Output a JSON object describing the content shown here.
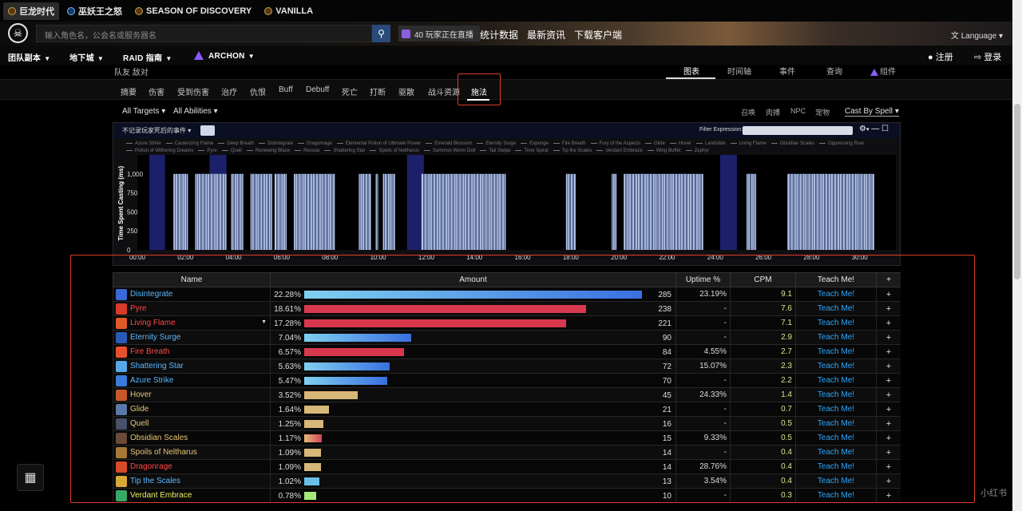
{
  "game_tabs": [
    "巨龙时代",
    "巫妖王之怒",
    "SEASON OF DISCOVERY",
    "VANILLA"
  ],
  "header": {
    "search_placeholder": "输入角色名，公会名或服务器名",
    "live_text": "40 玩家正在直播",
    "links": [
      "统计数据",
      "最新资讯",
      "下载客户端"
    ],
    "language": "Language"
  },
  "nav": {
    "items": [
      "团队副本",
      "地下城",
      "RAID 指南",
      "ARCHON"
    ],
    "register": "注册",
    "login": "登录"
  },
  "report": {
    "ally_enemy": "队友 敌对",
    "view_tabs": [
      "图表",
      "时间轴",
      "事件",
      "查询",
      "组件"
    ],
    "categories": [
      "摘要",
      "伤害",
      "受到伤害",
      "治疗",
      "仇恨",
      "Buff",
      "Debuff",
      "死亡",
      "打断",
      "驱散",
      "战斗资源",
      "施法"
    ],
    "targets": "All Targets",
    "abilities": "All Abilities",
    "right_filters": [
      "召唤",
      "肉搏",
      "NPC",
      "宠物"
    ],
    "cast_by": "Cast By Spell"
  },
  "chart_panel": {
    "event_dropdown": "不记录玩家死后的事件",
    "filter_label": "Filter Expression:"
  },
  "chart_data": {
    "type": "bar",
    "ylabel": "Time Spent Casting (ms)",
    "ylim": [
      0,
      1250
    ],
    "yticks": [
      "0",
      "250",
      "500",
      "750",
      "1,000"
    ],
    "xlim": [
      0,
      31.5
    ],
    "xticks": [
      "00:00",
      "02:00",
      "04:00",
      "06:00",
      "08:00",
      "10:00",
      "12:00",
      "14:00",
      "16:00",
      "18:00",
      "20:00",
      "22:00",
      "24:00",
      "26:00",
      "28:00",
      "30:00"
    ],
    "bar_value": 1000,
    "cast_windows": [
      {
        "start": 1.5,
        "end": 2.1
      },
      {
        "start": 2.4,
        "end": 3.7
      },
      {
        "start": 3.9,
        "end": 4.4
      },
      {
        "start": 4.7,
        "end": 5.6
      },
      {
        "start": 5.7,
        "end": 6.2
      },
      {
        "start": 6.5,
        "end": 8.2
      },
      {
        "start": 9.2,
        "end": 9.7
      },
      {
        "start": 9.9,
        "end": 10.0
      },
      {
        "start": 10.2,
        "end": 10.7
      },
      {
        "start": 11.8,
        "end": 15.3
      },
      {
        "start": 17.8,
        "end": 18.2
      },
      {
        "start": 19.7,
        "end": 19.9
      },
      {
        "start": 20.2,
        "end": 23.5
      },
      {
        "start": 25.3,
        "end": 25.7
      },
      {
        "start": 27.0,
        "end": 30.6
      }
    ],
    "boss_phases": [
      {
        "start": 0.5,
        "end": 1.15
      },
      {
        "start": 3.0,
        "end": 3.7
      },
      {
        "start": 11.2,
        "end": 11.9
      },
      {
        "start": 24.2,
        "end": 24.9
      }
    ],
    "legend": [
      "Azure Strike",
      "Cauterizing Flame",
      "Deep Breath",
      "Disintegrate",
      "Dragonrage",
      "Elemental Potion of Ultimate Power",
      "Emerald Blossom",
      "Eternity Surge",
      "Expunge",
      "Fire Breath",
      "Fury of the Aspects",
      "Glide",
      "Hover",
      "Landslide",
      "Living Flame",
      "Obsidian Scales",
      "Oppressing Roar",
      "Potion of Withering Dreams",
      "Pyre",
      "Quell",
      "Renewing Blaze",
      "Rescue",
      "Shattering Star",
      "Spoils of Neltharus",
      "Summon Worm Doll",
      "Tail Swipe",
      "Time Spiral",
      "Tip the Scales",
      "Verdant Embrace",
      "Wing Buffet",
      "Zephyr"
    ]
  },
  "table": {
    "headers": [
      "Name",
      "Amount",
      "Uptime %",
      "CPM",
      "Teach Me!",
      "+"
    ],
    "rows": [
      {
        "name": "Disintegrate",
        "pct": "22.28%",
        "value": 22.28,
        "casts": "285",
        "uptime": "23.19%",
        "cpm": "9.1",
        "teach": "Teach Me!",
        "name_color": "#5ab8ff",
        "bar_color": "linear-gradient(90deg,#7fd0f0,#3a70e0)",
        "icon_color": "#3a6ad8",
        "has_dropdown": false
      },
      {
        "name": "Pyre",
        "pct": "18.61%",
        "value": 18.61,
        "casts": "238",
        "uptime": "-",
        "cpm": "7.6",
        "teach": "Teach Me!",
        "name_color": "#ff4848",
        "bar_color": "#d8384e",
        "icon_color": "#d83a2a",
        "has_dropdown": false
      },
      {
        "name": "Living Flame",
        "pct": "17.28%",
        "value": 17.28,
        "casts": "221",
        "uptime": "-",
        "cpm": "7.1",
        "teach": "Teach Me!",
        "name_color": "#ff4848",
        "bar_color": "#d8384e",
        "icon_color": "#e05a28",
        "has_dropdown": true
      },
      {
        "name": "Eternity Surge",
        "pct": "7.04%",
        "value": 7.04,
        "casts": "90",
        "uptime": "-",
        "cpm": "2.9",
        "teach": "Teach Me!",
        "name_color": "#5ab8ff",
        "bar_color": "linear-gradient(90deg,#7fd0f0,#3a70e0)",
        "icon_color": "#2a5ab8",
        "has_dropdown": false
      },
      {
        "name": "Fire Breath",
        "pct": "6.57%",
        "value": 6.57,
        "casts": "84",
        "uptime": "4.55%",
        "cpm": "2.7",
        "teach": "Teach Me!",
        "name_color": "#ff4848",
        "bar_color": "#d8384e",
        "icon_color": "#e8502a",
        "has_dropdown": false
      },
      {
        "name": "Shattering Star",
        "pct": "5.63%",
        "value": 5.63,
        "casts": "72",
        "uptime": "15.07%",
        "cpm": "2.3",
        "teach": "Teach Me!",
        "name_color": "#5ab8ff",
        "bar_color": "linear-gradient(90deg,#7fd0f0,#3a70e0)",
        "icon_color": "#58a8e8",
        "has_dropdown": false
      },
      {
        "name": "Azure Strike",
        "pct": "5.47%",
        "value": 5.47,
        "casts": "70",
        "uptime": "-",
        "cpm": "2.2",
        "teach": "Teach Me!",
        "name_color": "#5ab8ff",
        "bar_color": "linear-gradient(90deg,#7fd0f0,#3a70e0)",
        "icon_color": "#3a7ad8",
        "has_dropdown": false
      },
      {
        "name": "Hover",
        "pct": "3.52%",
        "value": 3.52,
        "casts": "45",
        "uptime": "24.33%",
        "cpm": "1.4",
        "teach": "Teach Me!",
        "name_color": "#e8c878",
        "bar_color": "#d8b878",
        "icon_color": "#c8582a",
        "has_dropdown": false
      },
      {
        "name": "Glide",
        "pct": "1.64%",
        "value": 1.64,
        "casts": "21",
        "uptime": "-",
        "cpm": "0.7",
        "teach": "Teach Me!",
        "name_color": "#e8c878",
        "bar_color": "#d8b878",
        "icon_color": "#5a78a8",
        "has_dropdown": false
      },
      {
        "name": "Quell",
        "pct": "1.25%",
        "value": 1.25,
        "casts": "16",
        "uptime": "-",
        "cpm": "0.5",
        "teach": "Teach Me!",
        "name_color": "#e8c878",
        "bar_color": "#d8b878",
        "icon_color": "#48506a",
        "has_dropdown": false
      },
      {
        "name": "Obsidian Scales",
        "pct": "1.17%",
        "value": 1.17,
        "casts": "15",
        "uptime": "9.33%",
        "cpm": "0.5",
        "teach": "Teach Me!",
        "name_color": "#e8c878",
        "bar_color": "linear-gradient(90deg,#e8b878,#d04858)",
        "icon_color": "#6a4a38",
        "has_dropdown": false
      },
      {
        "name": "Spoils of Neltharus",
        "pct": "1.09%",
        "value": 1.09,
        "casts": "14",
        "uptime": "-",
        "cpm": "0.4",
        "teach": "Teach Me!",
        "name_color": "#e8c878",
        "bar_color": "#d8b878",
        "icon_color": "#a87838",
        "has_dropdown": false
      },
      {
        "name": "Dragonrage",
        "pct": "1.09%",
        "value": 1.09,
        "casts": "14",
        "uptime": "28.76%",
        "cpm": "0.4",
        "teach": "Teach Me!",
        "name_color": "#ff4848",
        "bar_color": "#d8b878",
        "icon_color": "#d84a2a",
        "has_dropdown": false
      },
      {
        "name": "Tip the Scales",
        "pct": "1.02%",
        "value": 1.02,
        "casts": "13",
        "uptime": "3.54%",
        "cpm": "0.4",
        "teach": "Teach Me!",
        "name_color": "#5ab8ff",
        "bar_color": "#68c0e8",
        "icon_color": "#d8a838",
        "has_dropdown": false
      },
      {
        "name": "Verdant Embrace",
        "pct": "0.78%",
        "value": 0.78,
        "casts": "10",
        "uptime": "-",
        "cpm": "0.3",
        "teach": "Teach Me!",
        "name_color": "#e8f060",
        "bar_color": "#a8e878",
        "icon_color": "#38a868",
        "has_dropdown": false
      }
    ]
  }
}
